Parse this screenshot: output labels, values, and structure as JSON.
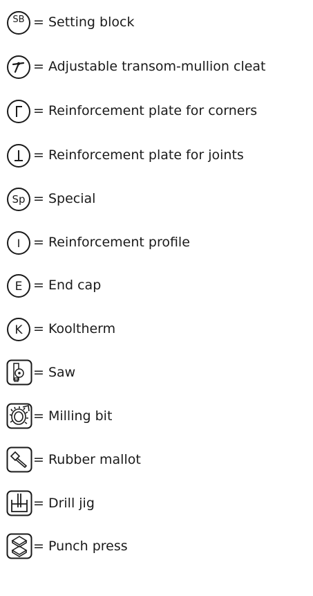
{
  "legend": {
    "items": [
      {
        "symbol_text": "SB",
        "icon": "setting-block-icon",
        "label": "= Setting block"
      },
      {
        "symbol_text": "",
        "icon": "cleat-icon",
        "label": "= Adjustable transom-mullion cleat"
      },
      {
        "symbol_text": "Γ",
        "icon": "corner-plate-icon",
        "label": "= Reinforcement plate for corners"
      },
      {
        "symbol_text": "⊥",
        "icon": "joint-plate-icon",
        "label": "= Reinforcement plate for joints"
      },
      {
        "symbol_text": "Sp",
        "icon": "special-icon",
        "label": "= Special"
      },
      {
        "symbol_text": "I",
        "icon": "reinforcement-profile-icon",
        "label": "= Reinforcement profile"
      },
      {
        "symbol_text": "E",
        "icon": "end-cap-icon",
        "label": "= End cap"
      },
      {
        "symbol_text": "K",
        "icon": "kooltherm-icon",
        "label": "= Kooltherm"
      },
      {
        "symbol_text": "",
        "icon": "saw-icon",
        "label": "= Saw"
      },
      {
        "symbol_text": "",
        "icon": "milling-bit-icon",
        "label": "= Milling bit"
      },
      {
        "symbol_text": "",
        "icon": "rubber-mallot-icon",
        "label": "= Rubber mallot"
      },
      {
        "symbol_text": "",
        "icon": "drill-jig-icon",
        "label": "= Drill jig"
      },
      {
        "symbol_text": "",
        "icon": "punch-press-icon",
        "label": "= Punch press"
      }
    ]
  }
}
